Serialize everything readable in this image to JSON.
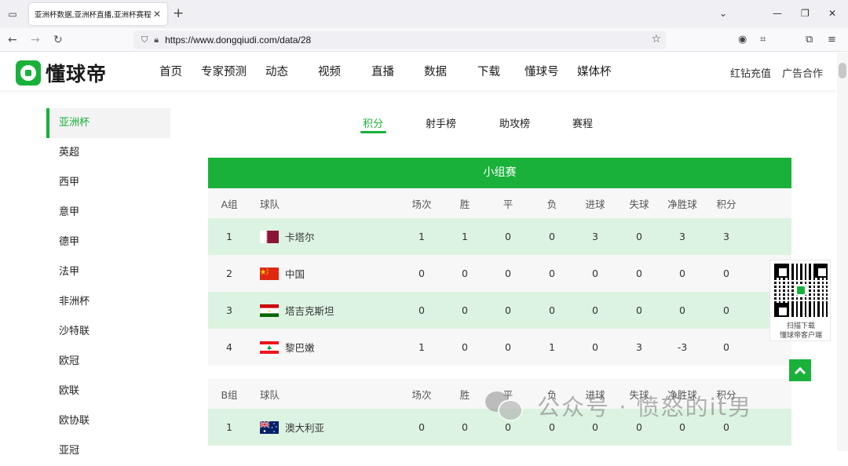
{
  "browser": {
    "tab_title": "亚洲杯数据,亚洲杯直播,亚洲杯赛程",
    "url": "https://www.dongqiudi.com/data/28"
  },
  "site": {
    "logo_text": "懂球帝",
    "nav": [
      "首页",
      "专家预测",
      "动态",
      "视频",
      "直播",
      "数据",
      "下载",
      "懂球号",
      "媒体杯"
    ],
    "header_right": [
      "红钻充值",
      "广告合作"
    ]
  },
  "sidebar": {
    "items": [
      "亚洲杯",
      "英超",
      "西甲",
      "意甲",
      "德甲",
      "法甲",
      "非洲杯",
      "沙特联",
      "欧冠",
      "欧联",
      "欧协联",
      "亚冠"
    ],
    "active_index": 0
  },
  "content_tabs": {
    "items": [
      "积分",
      "射手榜",
      "助攻榜",
      "赛程"
    ],
    "active_index": 0
  },
  "standings": {
    "title": "小组赛",
    "columns": [
      "球队",
      "场次",
      "胜",
      "平",
      "负",
      "进球",
      "失球",
      "净胜球",
      "积分"
    ],
    "groups": [
      {
        "name": "A组",
        "rows": [
          {
            "rank": "1",
            "team": "卡塔尔",
            "flag": "qatar",
            "stats": [
              "1",
              "1",
              "0",
              "0",
              "3",
              "0",
              "3",
              "3"
            ]
          },
          {
            "rank": "2",
            "team": "中国",
            "flag": "china",
            "stats": [
              "0",
              "0",
              "0",
              "0",
              "0",
              "0",
              "0",
              "0"
            ]
          },
          {
            "rank": "3",
            "team": "塔吉克斯坦",
            "flag": "tajikistan",
            "stats": [
              "0",
              "0",
              "0",
              "0",
              "0",
              "0",
              "0",
              "0"
            ]
          },
          {
            "rank": "4",
            "team": "黎巴嫩",
            "flag": "lebanon",
            "stats": [
              "1",
              "0",
              "0",
              "1",
              "0",
              "3",
              "-3",
              "0"
            ]
          }
        ]
      },
      {
        "name": "B组",
        "rows": [
          {
            "rank": "1",
            "team": "澳大利亚",
            "flag": "australia",
            "stats": [
              "0",
              "0",
              "0",
              "0",
              "0",
              "0",
              "0",
              "0"
            ]
          }
        ]
      }
    ]
  },
  "qr_widget": {
    "line1": "扫描下载",
    "line2": "懂球帝客户端"
  },
  "watermark": {
    "text": "公众号 · 愤怒的it男"
  },
  "colors": {
    "accent": "#19b13a",
    "row_highlight": "#ddf3e1"
  }
}
